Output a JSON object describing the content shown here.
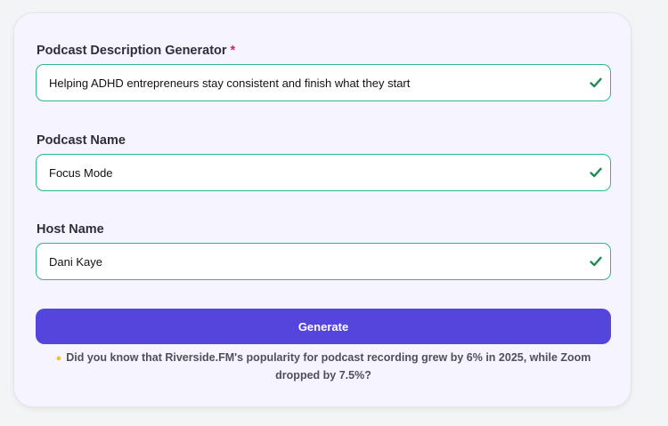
{
  "form": {
    "description": {
      "label": "Podcast Description Generator",
      "required_marker": "*",
      "value": "Helping ADHD entrepreneurs stay consistent and finish what they start",
      "icon": "check-icon"
    },
    "podcast_name": {
      "label": "Podcast Name",
      "value": "Focus Mode",
      "icon": "check-icon"
    },
    "host_name": {
      "label": "Host Name",
      "value": "Dani Kaye",
      "icon": "check-icon"
    },
    "generate_label": "Generate"
  },
  "tip": {
    "icon": "lightbulb-icon",
    "text": "Did you know that Riverside.FM's popularity for podcast recording grew by 6% in 2025, while Zoom dropped by 7.5%?"
  },
  "colors": {
    "accent": "#5445dd",
    "valid": "#1e8a55",
    "input_border": "#2bb890",
    "required": "#e0245e",
    "card_background": "#f6f4fe"
  }
}
